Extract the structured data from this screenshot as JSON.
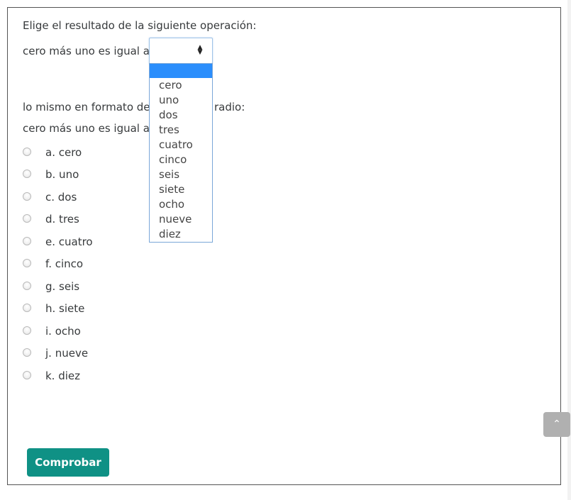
{
  "question1": {
    "prompt": "Elige el resultado de la siguiente operación:",
    "operation_label": "cero más uno es igual a",
    "select": {
      "selected_value": "",
      "options": [
        "cero",
        "uno",
        "dos",
        "tres",
        "cuatro",
        "cinco",
        "seis",
        "siete",
        "ocho",
        "nueve",
        "diez"
      ]
    }
  },
  "question2": {
    "prompt_left": "lo mismo en formato de",
    "prompt_right": "radio:",
    "operation_label": "cero más uno es igual a",
    "radio_options": [
      "a. cero",
      "b. uno",
      "c. dos",
      "d. tres",
      "e. cuatro",
      "f. cinco",
      "g. seis",
      "h. siete",
      "i. ocho",
      "j. nueve",
      "k. diez"
    ]
  },
  "buttons": {
    "check_label": "Comprobar"
  },
  "icons": {
    "select_arrows": "sort-arrows-icon",
    "scroll_top": "chevron-up-icon"
  },
  "colors": {
    "accent": "#0f9185",
    "dropdown_highlight": "#2b8efc"
  }
}
